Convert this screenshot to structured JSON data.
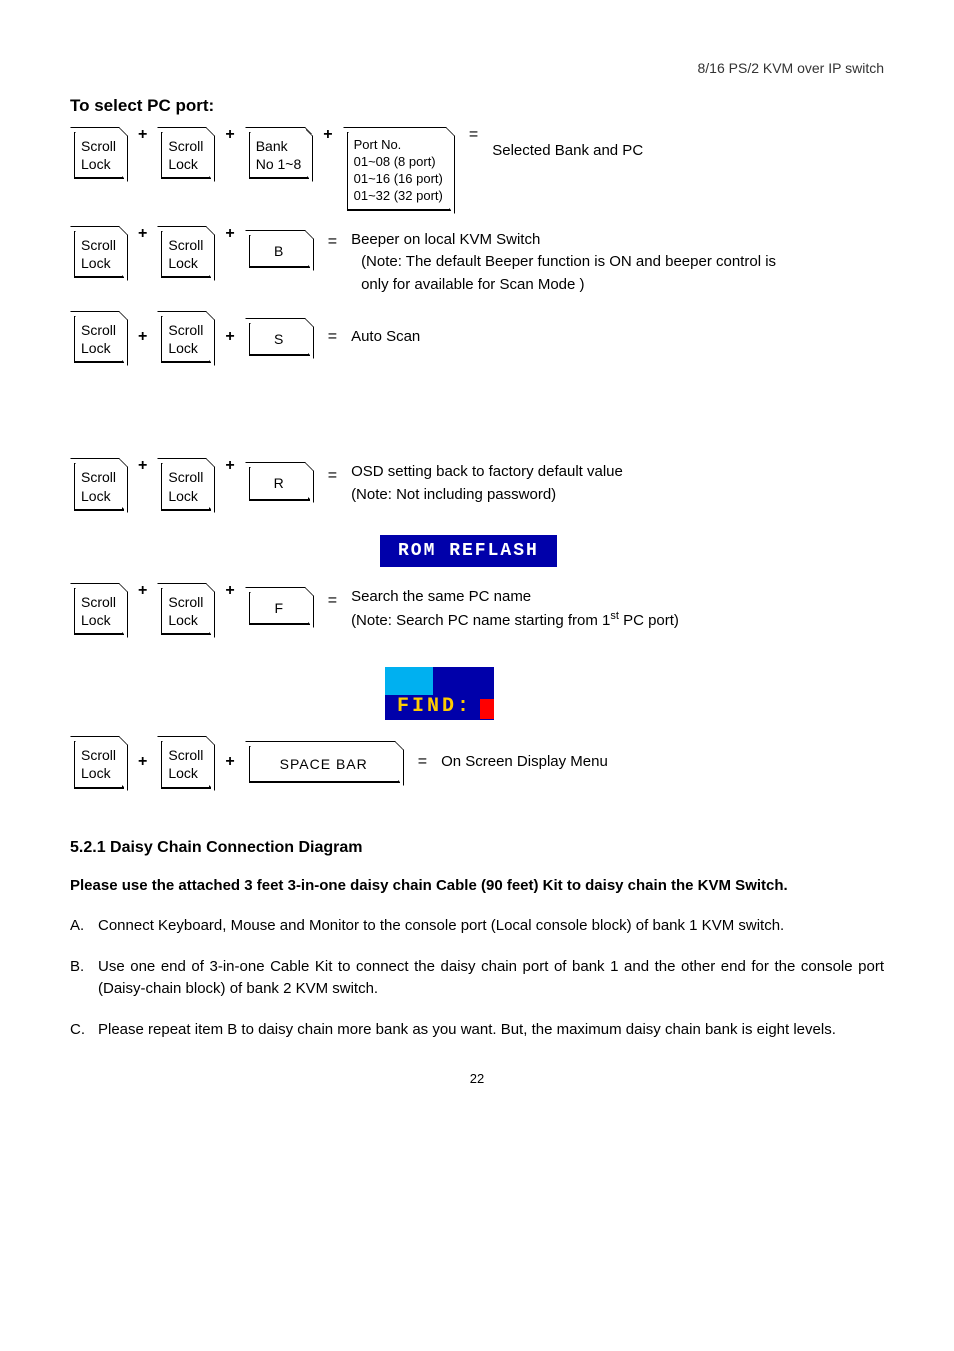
{
  "header": "8/16 PS/2 KVM over IP switch",
  "section_title": "To select PC port:",
  "keys": {
    "scroll": "Scroll\nLock",
    "bank": "Bank\nNo 1~8",
    "portno": "Port No.\n01~08 (8 port)\n01~16 (16 port)\n01~32 (32 port)",
    "B": "B",
    "S": "S",
    "R": "R",
    "F": "F",
    "space": "SPACE  BAR"
  },
  "plus": "+",
  "eq": "=",
  "line1_desc": "Selected Bank and PC",
  "line2_main": "Beeper on local KVM Switch",
  "line2_note": "(Note: The default Beeper function is ON and beeper control is only for available for Scan Mode )",
  "line3_desc": "Auto Scan",
  "line4_main": "OSD setting back to factory default value",
  "line4_note": "(Note: Not including password)",
  "rom_bar": "ROM  REFLASH",
  "line5_main": "Search the same PC name",
  "line5_note_pre": "(Note: Search PC name starting from 1",
  "line5_note_sup": "st",
  "line5_note_post": " PC port)",
  "find_text": "FIND:",
  "line6_desc": "On Screen Display Menu",
  "subhead": "5.2.1  Daisy Chain Connection Diagram",
  "bold_para": "Please use the attached 3 feet 3-in-one daisy chain Cable (90 feet) Kit to daisy chain the KVM Switch.",
  "list": {
    "a_marker": "A.",
    "a": "Connect Keyboard, Mouse and Monitor to the console port (Local console block) of bank 1 KVM switch.",
    "b_marker": "B.",
    "b": "Use one end of 3-in-one Cable Kit to connect the daisy chain port of bank 1 and the other end for the console port (Daisy-chain block) of bank 2 KVM switch.",
    "c_marker": "C.",
    "c": "Please repeat item B to daisy chain more bank as you want. But, the maximum daisy chain bank is eight levels."
  },
  "page_num": "22"
}
